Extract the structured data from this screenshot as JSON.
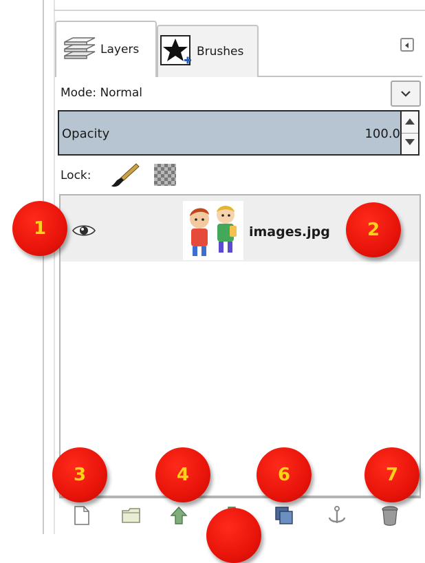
{
  "tabs": [
    {
      "label": "Layers",
      "icon": "layers-icon",
      "selected": true
    },
    {
      "label": "Brushes",
      "icon": "star-brush-icon",
      "selected": false
    }
  ],
  "mode": {
    "label": "Mode: Normal"
  },
  "opacity": {
    "label": "Opacity",
    "value": "100.0"
  },
  "lock": {
    "label": "Lock:"
  },
  "layers": [
    {
      "name": "images.jpg",
      "visible": true
    }
  ],
  "markers": [
    "1",
    "2",
    "3",
    "4",
    "6",
    "7"
  ],
  "footer_buttons": [
    "new-layer-icon",
    "new-group-icon",
    "raise-layer-icon",
    "lower-layer-icon",
    "duplicate-layer-icon",
    "anchor-layer-icon",
    "delete-layer-icon"
  ],
  "colors": {
    "marker_fill": "#e8140a",
    "marker_text": "#ffd21a",
    "opacity_fill": "#b7c5d2",
    "selected_row": "#eeeeee"
  }
}
